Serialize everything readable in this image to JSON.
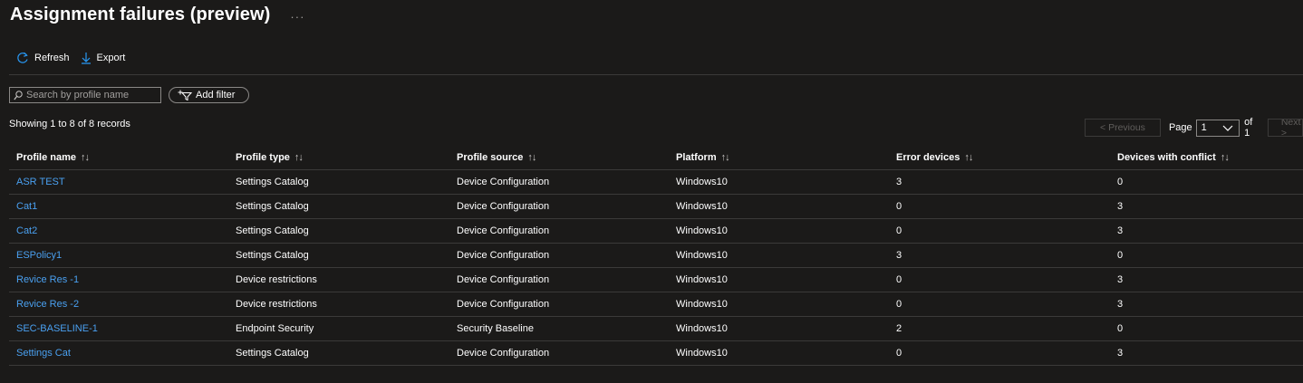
{
  "header": {
    "title": "Assignment failures (preview)",
    "more": "···"
  },
  "toolbar": {
    "refresh_label": "Refresh",
    "export_label": "Export"
  },
  "search": {
    "placeholder": "Search by profile name",
    "value": ""
  },
  "filter": {
    "label": "Add filter"
  },
  "records": {
    "text": "Showing 1 to 8 of 8 records"
  },
  "pager": {
    "previous": "< Previous",
    "page_label": "Page",
    "page_value": "1",
    "of_label": "of 1",
    "next": "Next >"
  },
  "table": {
    "columns": [
      "Profile name",
      "Profile type",
      "Profile source",
      "Platform",
      "Error devices",
      "Devices with conflict"
    ],
    "sort_glyph": "↑↓",
    "rows": [
      [
        "ASR TEST",
        "Settings Catalog",
        "Device Configuration",
        "Windows10",
        "3",
        "0"
      ],
      [
        "Cat1",
        "Settings Catalog",
        "Device Configuration",
        "Windows10",
        "0",
        "3"
      ],
      [
        "Cat2",
        "Settings Catalog",
        "Device Configuration",
        "Windows10",
        "0",
        "3"
      ],
      [
        "ESPolicy1",
        "Settings Catalog",
        "Device Configuration",
        "Windows10",
        "3",
        "0"
      ],
      [
        "Revice Res -1",
        "Device restrictions",
        "Device Configuration",
        "Windows10",
        "0",
        "3"
      ],
      [
        "Revice Res -2",
        "Device restrictions",
        "Device Configuration",
        "Windows10",
        "0",
        "3"
      ],
      [
        "SEC-BASELINE-1",
        "Endpoint Security",
        "Security Baseline",
        "Windows10",
        "2",
        "0"
      ],
      [
        "Settings Cat",
        "Settings Catalog",
        "Device Configuration",
        "Windows10",
        "0",
        "3"
      ]
    ]
  },
  "colors": {
    "background": "#1b1a19",
    "link": "#4aa0f0",
    "accent": "#2899f5",
    "border": "#3b3a39"
  },
  "icons": {
    "refresh": "refresh-icon",
    "export": "download-icon",
    "search": "search-icon",
    "filter": "add-filter-icon",
    "dropdown": "chevron-down-icon"
  }
}
